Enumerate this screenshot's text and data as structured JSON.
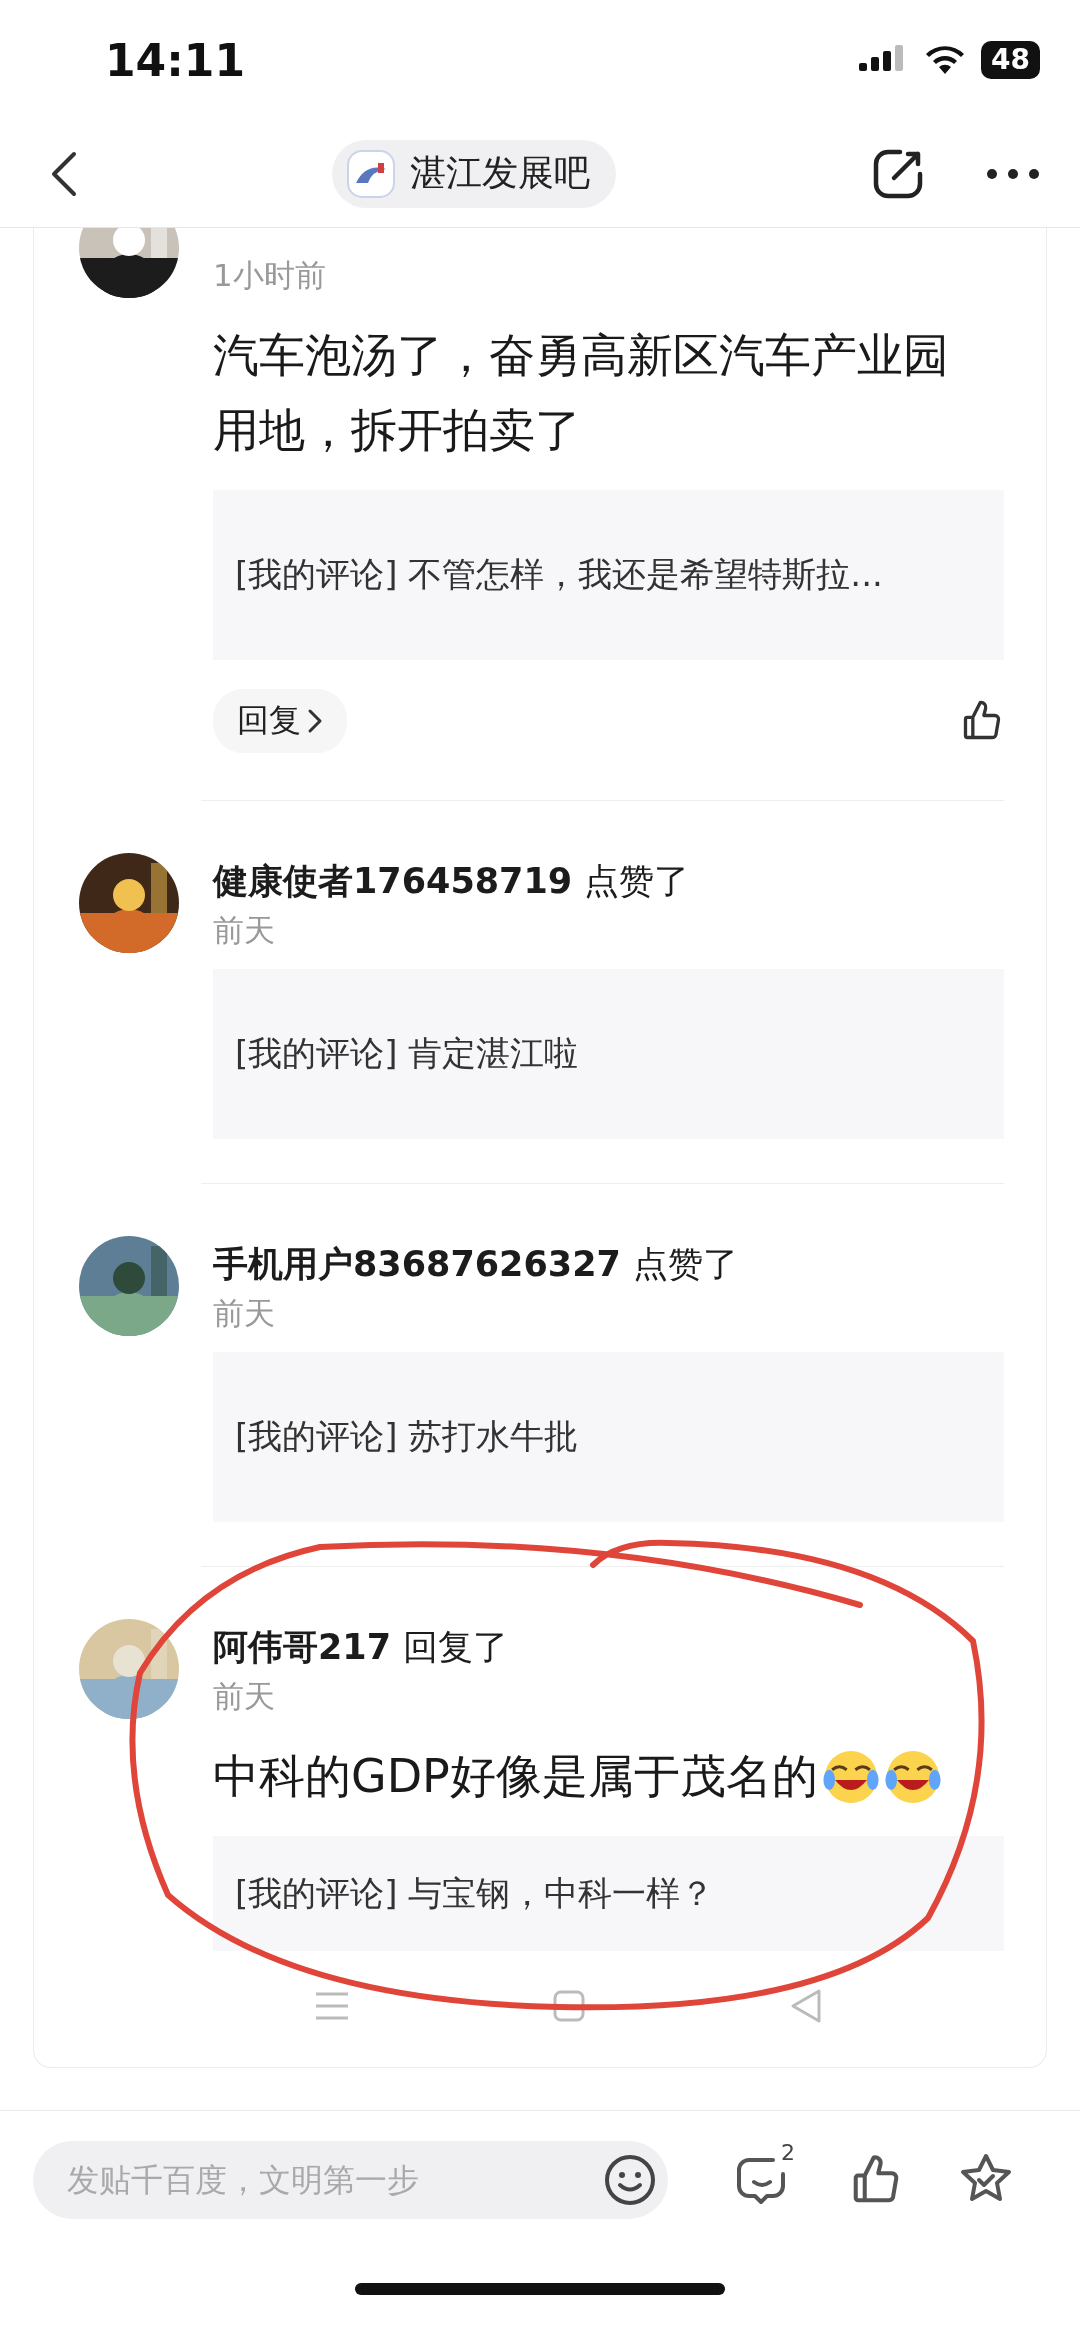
{
  "status_bar": {
    "time": "14:11",
    "battery": "48"
  },
  "nav": {
    "forum_name": "湛江发展吧"
  },
  "notifications": [
    {
      "kind": "reply",
      "time": "1小时前",
      "content": "汽车泡汤了，奋勇高新区汽车产业园用地，拆开拍卖了",
      "quote": "[我的评论] 不管怎样，我还是希望特斯拉...",
      "footer": {
        "kind": "actions",
        "reply_label": "回复"
      }
    },
    {
      "kind": "like",
      "name": "健康使者176458719",
      "action": "点赞了",
      "time": "前天",
      "quote": "[我的评论] 肯定湛江啦"
    },
    {
      "kind": "like",
      "name": "手机用户83687626327",
      "action": "点赞了",
      "time": "前天",
      "quote": "[我的评论] 苏打水牛批"
    },
    {
      "kind": "reply",
      "name": "阿伟哥217",
      "action": "回复了",
      "time": "前天",
      "content": "中科的GDP好像是属于茂名的",
      "emojis": [
        {
          "kind": "laugh-cry"
        },
        {
          "kind": "laugh-cry"
        }
      ],
      "quote": "[我的评论] 与宝钢，中科一样？",
      "footer": {
        "kind": "nav_icons"
      }
    }
  ],
  "bottom_bar": {
    "placeholder": "发贴千百度，文明第一步",
    "comment_badge": "2"
  }
}
